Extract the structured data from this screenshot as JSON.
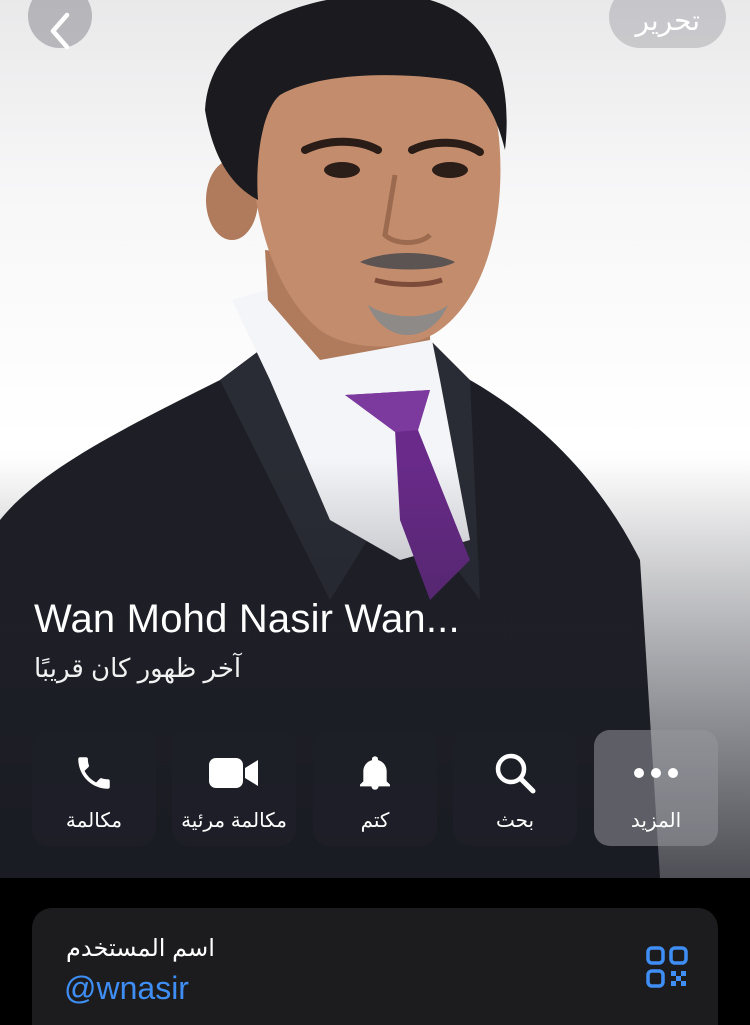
{
  "topbar": {
    "back_icon": "chevron-left-icon",
    "edit_label": "تحرير"
  },
  "profile": {
    "name": "Wan Mohd Nasir Wan...",
    "status": "آخر ظهور كان قريبًا"
  },
  "actions": [
    {
      "label": "مكالمة",
      "icon": "phone-icon"
    },
    {
      "label": "مكالمة مرئية",
      "icon": "video-camera-icon"
    },
    {
      "label": "كتم",
      "icon": "bell-icon"
    },
    {
      "label": "بحث",
      "icon": "search-icon"
    },
    {
      "label": "المزيد",
      "icon": "more-dots-icon"
    }
  ],
  "info": {
    "username_caption": "اسم المستخدم",
    "username_value": "@wnasir",
    "qr_icon": "qr-code-icon"
  },
  "colors": {
    "accent": "#3e8ef5",
    "card_bg": "#1c1c1e",
    "tie": "#6a2a8a"
  }
}
